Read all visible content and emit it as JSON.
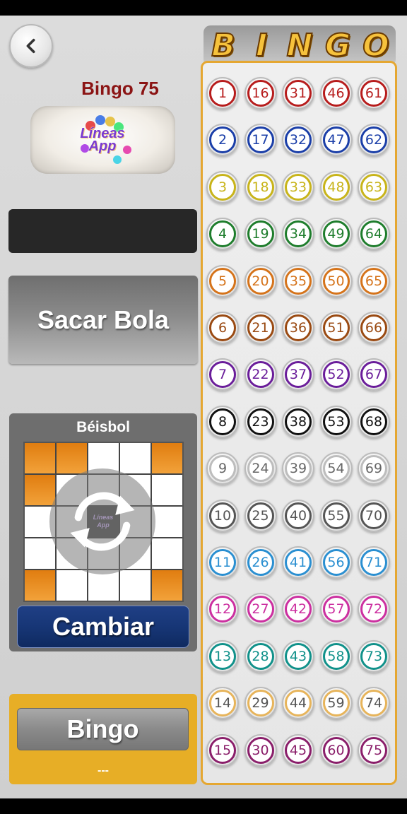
{
  "left_panel": {
    "game_title": "Bingo 75",
    "logo_text": "Líneas App",
    "draw_button_label": "Sacar Bola",
    "pattern_name": "Béisbol",
    "pattern_cells": [
      1,
      1,
      0,
      0,
      1,
      1,
      0,
      0,
      0,
      0,
      0,
      0,
      2,
      0,
      0,
      0,
      0,
      0,
      0,
      0,
      1,
      0,
      0,
      0,
      1
    ],
    "change_button_label": "Cambiar",
    "bingo_button_label": "Bingo",
    "bingo_status": "---"
  },
  "board": {
    "letters": [
      "B",
      "I",
      "N",
      "G",
      "O"
    ],
    "row_colors": [
      "#b71c1c",
      "#1a3ea8",
      "#c8b41a",
      "#1e7d2c",
      "#d5731a",
      "#9a4a12",
      "#6a1d9a",
      "#111111",
      "#bdbdbd",
      "#555555",
      "#2a8fd1",
      "#cc2fa0",
      "#10918a",
      "#e7b45a",
      "#8a1e6a"
    ],
    "rows": [
      [
        1,
        16,
        31,
        46,
        61
      ],
      [
        2,
        17,
        32,
        47,
        62
      ],
      [
        3,
        18,
        33,
        48,
        63
      ],
      [
        4,
        19,
        34,
        49,
        64
      ],
      [
        5,
        20,
        35,
        50,
        65
      ],
      [
        6,
        21,
        36,
        51,
        66
      ],
      [
        7,
        22,
        37,
        52,
        67
      ],
      [
        8,
        23,
        38,
        53,
        68
      ],
      [
        9,
        24,
        39,
        54,
        69
      ],
      [
        10,
        25,
        40,
        55,
        70
      ],
      [
        11,
        26,
        41,
        56,
        71
      ],
      [
        12,
        27,
        42,
        57,
        72
      ],
      [
        13,
        28,
        43,
        58,
        73
      ],
      [
        14,
        29,
        44,
        59,
        74
      ],
      [
        15,
        30,
        45,
        60,
        75
      ]
    ]
  }
}
